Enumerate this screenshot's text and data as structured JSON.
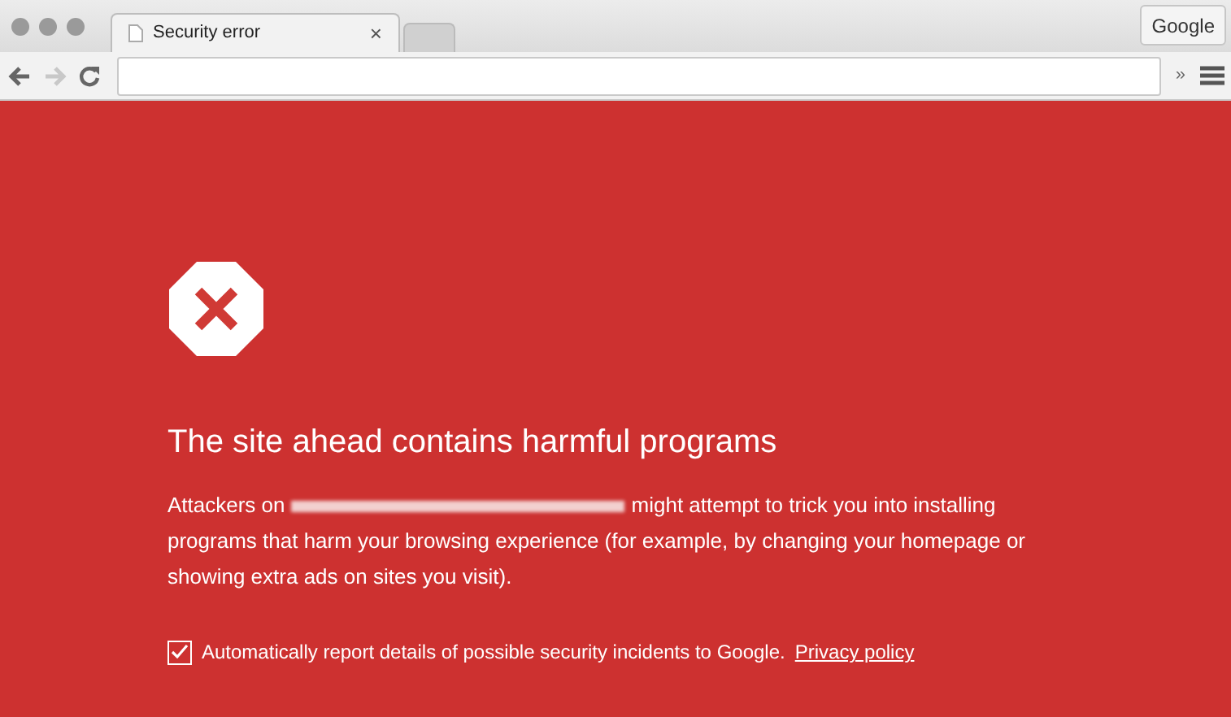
{
  "tabs": [
    {
      "title": "Security error",
      "close": "×",
      "selected": true
    },
    {
      "selected": false
    }
  ],
  "profile_button": "Google",
  "toolbar": {
    "overflow": "»"
  },
  "page": {
    "heading": "The site ahead contains harmful programs",
    "intro": "Attackers on",
    "body_first_line": "might attempt to trick you into installing",
    "body": "programs that harm your browsing experience (for example, by changing your homepage or showing extra ads on sites you visit).",
    "report": {
      "checked": true,
      "label": "Automatically report details of possible security incidents to Google.",
      "link": "Privacy policy"
    }
  }
}
